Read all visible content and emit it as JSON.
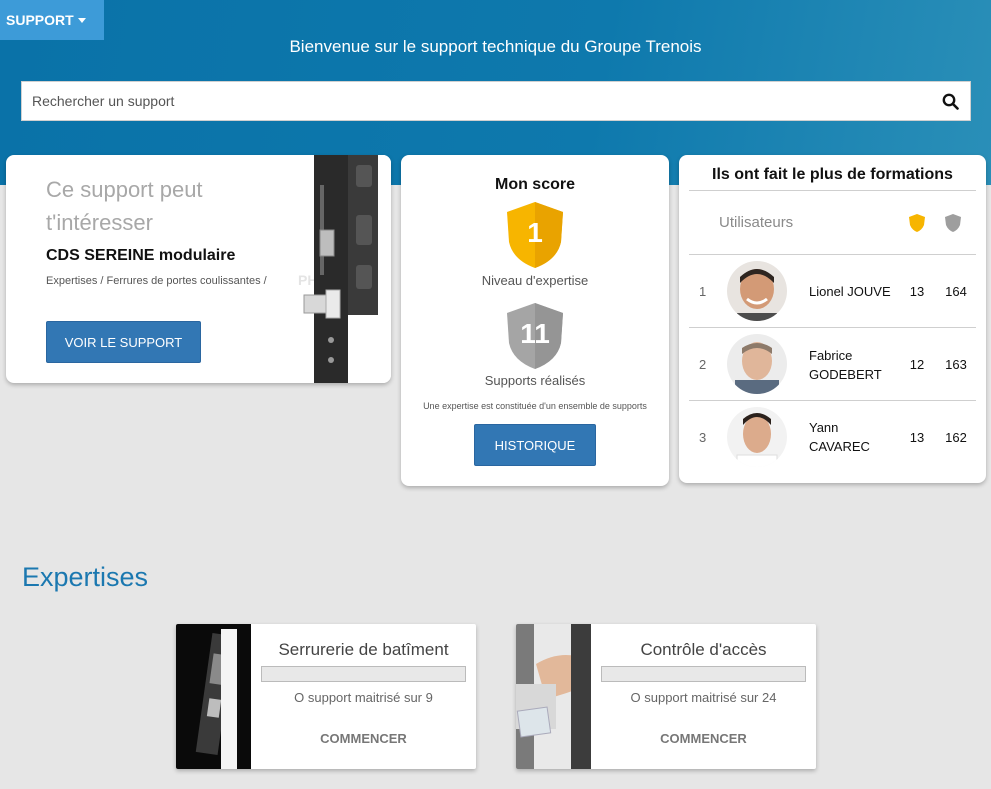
{
  "header": {
    "menu_label": "SUPPORT",
    "welcome": "Bienvenue sur le support technique du Groupe Trenois",
    "search_placeholder": "Rechercher un support"
  },
  "suggestion": {
    "title": "Ce support peut t'intéresser",
    "product_name": "CDS SEREINE modulaire",
    "path": "Expertises / Ferrures de portes coulissantes /",
    "button": "VOIR LE SUPPORT",
    "watermark": "PH"
  },
  "score": {
    "title": "Mon score",
    "level_value": "1",
    "level_label": "Niveau d'expertise",
    "supports_value": "11",
    "supports_label": "Supports réalisés",
    "note": "Une expertise est constituée d'un ensemble de supports",
    "button": "HISTORIQUE",
    "colors": {
      "gold": "#f7b500",
      "silver": "#9e9e9e"
    }
  },
  "leaderboard": {
    "title": "Ils ont fait le plus de formations",
    "users_header": "Utilisateurs",
    "rows": [
      {
        "rank": "1",
        "name": "Lionel JOUVE",
        "score_gold": "13",
        "score_silver": "164"
      },
      {
        "rank": "2",
        "name": "Fabrice GODEBERT",
        "score_gold": "12",
        "score_silver": "163"
      },
      {
        "rank": "3",
        "name": "Yann CAVAREC",
        "score_gold": "13",
        "score_silver": "162"
      }
    ]
  },
  "expertises": {
    "title": "Expertises",
    "cards": [
      {
        "name": "Serrurerie de batîment",
        "progress": 0,
        "count": "O support maitrisé sur 9",
        "action": "COMMENCER"
      },
      {
        "name": "Contrôle d'accès",
        "progress": 0,
        "count": "O support maitrisé sur 24",
        "action": "COMMENCER"
      }
    ]
  }
}
